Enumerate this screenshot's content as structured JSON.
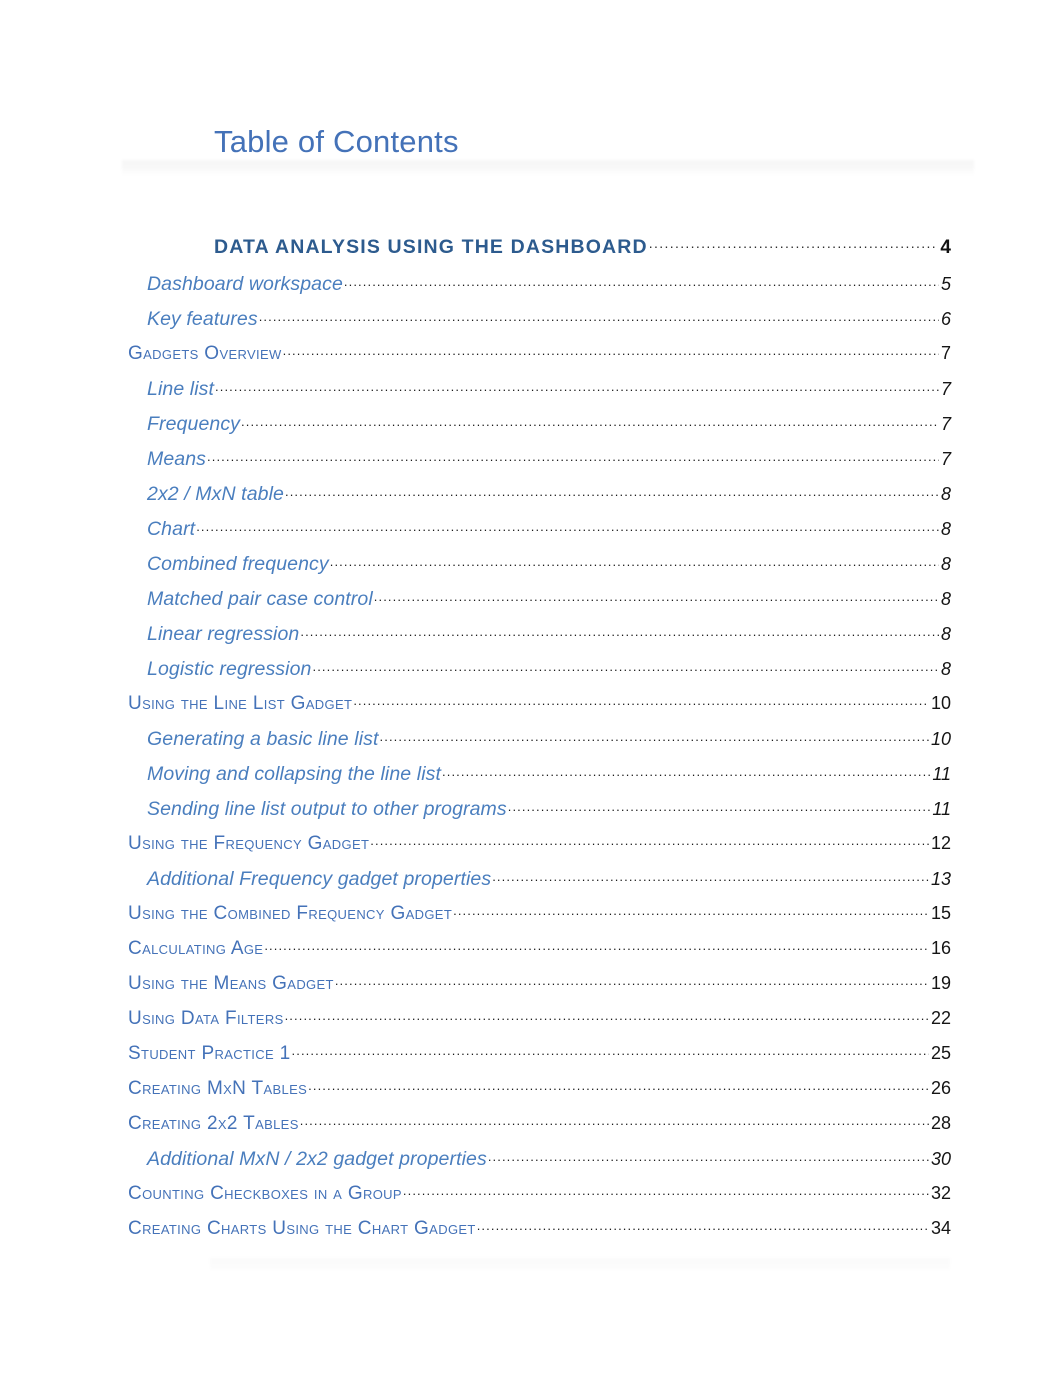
{
  "document": {
    "title": "Table of Contents"
  },
  "toc": {
    "entries": [
      {
        "level": 0,
        "label": "Data Analysis Using the Dashboard",
        "page": "4"
      },
      {
        "level": 2,
        "label": "Dashboard workspace",
        "page": "5"
      },
      {
        "level": 2,
        "label": "Key features",
        "page": "6"
      },
      {
        "level": 1,
        "label": "Gadgets Overview",
        "page": "7"
      },
      {
        "level": 2,
        "label": "Line list",
        "page": "7"
      },
      {
        "level": 2,
        "label": "Frequency",
        "page": "7"
      },
      {
        "level": 2,
        "label": "Means",
        "page": "7"
      },
      {
        "level": 2,
        "label": "2x2 / MxN table",
        "page": "8"
      },
      {
        "level": 2,
        "label": "Chart",
        "page": "8"
      },
      {
        "level": 2,
        "label": "Combined frequency",
        "page": "8"
      },
      {
        "level": 2,
        "label": "Matched pair case control",
        "page": "8"
      },
      {
        "level": 2,
        "label": "Linear regression",
        "page": "8"
      },
      {
        "level": 2,
        "label": "Logistic regression",
        "page": "8"
      },
      {
        "level": 1,
        "label": "Using the Line List Gadget",
        "page": "10"
      },
      {
        "level": 2,
        "label": "Generating a basic line list",
        "page": "10"
      },
      {
        "level": 2,
        "label": "Moving and collapsing the line list",
        "page": "11"
      },
      {
        "level": 2,
        "label": "Sending line list output to other programs",
        "page": "11"
      },
      {
        "level": 1,
        "label": "Using the Frequency Gadget",
        "page": "12"
      },
      {
        "level": 2,
        "label": "Additional Frequency gadget properties",
        "page": "13"
      },
      {
        "level": 1,
        "label": "Using the Combined Frequency Gadget",
        "page": "15"
      },
      {
        "level": 1,
        "label": "Calculating Age",
        "page": "16"
      },
      {
        "level": 1,
        "label": "Using the Means Gadget",
        "page": "19"
      },
      {
        "level": 1,
        "label": "Using Data Filters",
        "page": "22"
      },
      {
        "level": 1,
        "label": "Student Practice 1",
        "page": "25"
      },
      {
        "level": 1,
        "label": "Creating MxN Tables",
        "page": "26"
      },
      {
        "level": 1,
        "label": "Creating 2x2 Tables",
        "page": "28"
      },
      {
        "level": 2,
        "label": "Additional MxN / 2x2 gadget properties",
        "page": "30"
      },
      {
        "level": 1,
        "label": "Counting Checkboxes in a Group",
        "page": "32"
      },
      {
        "level": 1,
        "label": "Creating Charts Using the Chart Gadget",
        "page": "34"
      }
    ]
  },
  "colors": {
    "title_blue": "#4472B8",
    "heading_dark_blue": "#2D5B8E",
    "level1_blue": "#4472B8",
    "level2_blue": "#4A7EBE",
    "page_number": "#151515",
    "page_background": "#FFFFFF"
  }
}
